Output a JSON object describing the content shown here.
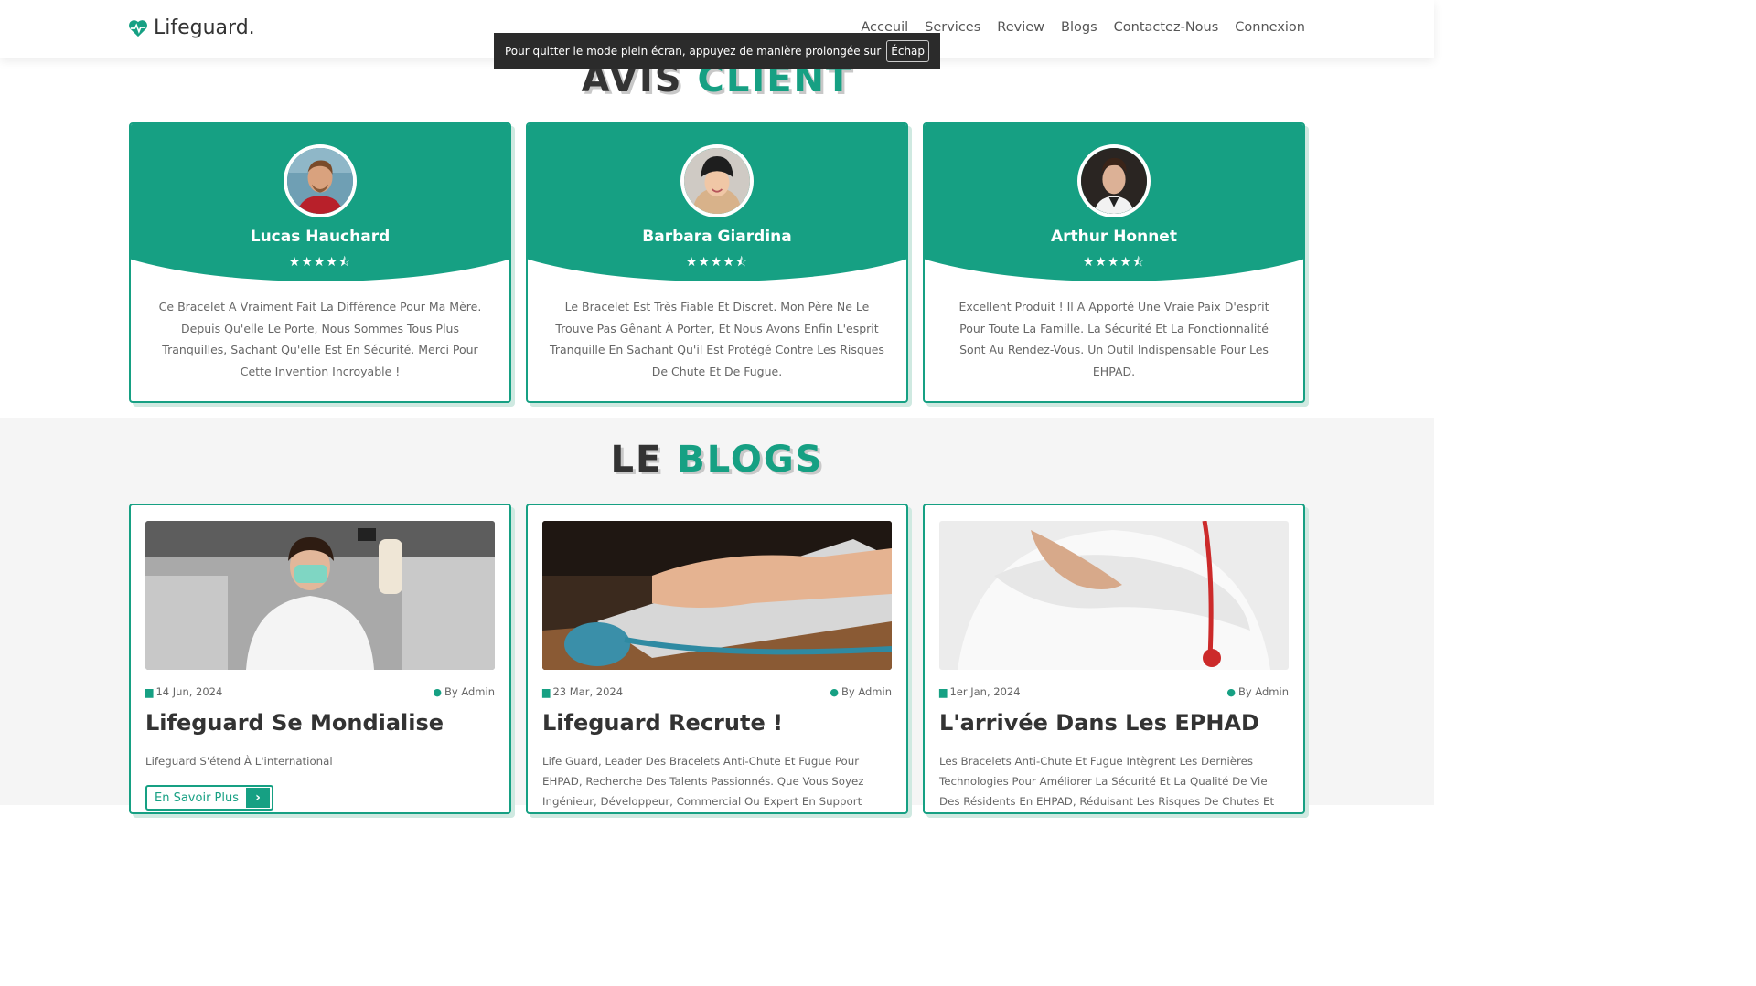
{
  "header": {
    "logo_text": "Lifeguard.",
    "logo_icon": "heart-pulse-icon",
    "nav": [
      "Acceuil",
      "Services",
      "Review",
      "Blogs",
      "Contactez-Nous",
      "Connexion"
    ]
  },
  "fullscreen_toast": {
    "message": "Pour quitter le mode plein écran, appuyez de manière prolongée sur",
    "key": "Échap"
  },
  "reviews_section": {
    "title_dark": "Avis",
    "title_green": "Client",
    "reviews": [
      {
        "name": "Lucas Hauchard",
        "stars": "★★★★⯪",
        "rating": 4.5,
        "text": "Ce Bracelet A Vraiment Fait La Différence Pour Ma Mère. Depuis Qu'elle Le Porte, Nous Sommes Tous Plus Tranquilles, Sachant Qu'elle Est En Sécurité. Merci Pour Cette Invention Incroyable !"
      },
      {
        "name": "Barbara Giardina",
        "stars": "★★★★⯪",
        "rating": 4.5,
        "text": "Le Bracelet Est Très Fiable Et Discret. Mon Père Ne Le Trouve Pas Gênant À Porter, Et Nous Avons Enfin L'esprit Tranquille En Sachant Qu'il Est Protégé Contre Les Risques De Chute Et De Fugue."
      },
      {
        "name": "Arthur Honnet",
        "stars": "★★★★⯪",
        "rating": 4.5,
        "text": "Excellent Produit ! Il A Apporté Une Vraie Paix D'esprit Pour Toute La Famille. La Sécurité Et La Fonctionnalité Sont Au Rendez-Vous. Un Outil Indispensable Pour Les EHPAD."
      }
    ]
  },
  "blogs_section": {
    "title_dark": "Le",
    "title_green": "Blogs",
    "posts": [
      {
        "date": "14 Jun, 2024",
        "author": "By Admin",
        "title": "Lifeguard Se Mondialise",
        "desc": "Lifeguard S'étend À L'international",
        "button": "En Savoir Plus"
      },
      {
        "date": "23 Mar, 2024",
        "author": "By Admin",
        "title": "Lifeguard Recrute !",
        "desc": "Life Guard, Leader Des Bracelets Anti-Chute Et Fugue Pour EHPAD, Recherche Des Talents Passionnés. Que Vous Soyez Ingénieur, Développeur, Commercial Ou Expert En Support",
        "button": ""
      },
      {
        "date": "1er Jan, 2024",
        "author": "By Admin",
        "title": "L'arrivée Dans Les EPHAD",
        "desc": "Les Bracelets Anti-Chute Et Fugue Intègrent Les Dernières Technologies Pour Améliorer La Sécurité Et La Qualité De Vie Des Résidents En EHPAD, Réduisant Les Risques De Chutes Et",
        "button": ""
      }
    ]
  },
  "colors": {
    "accent": "#16a083",
    "heading_dark": "#333333",
    "blogs_bg": "#f5f5f5"
  }
}
